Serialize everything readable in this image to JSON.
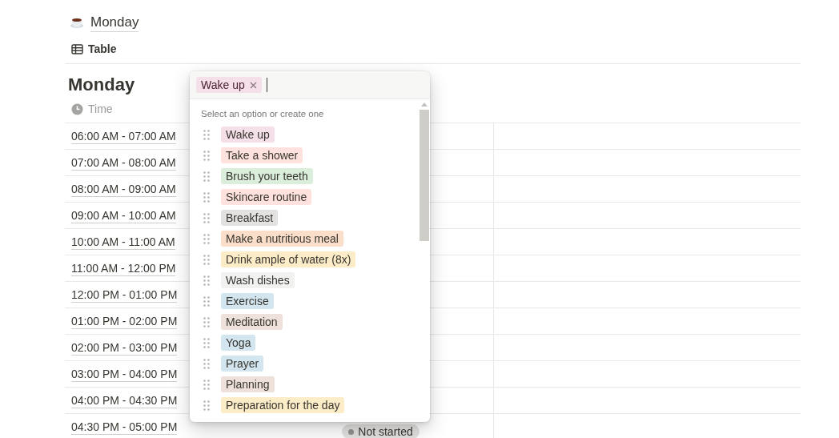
{
  "page": {
    "title": "Monday"
  },
  "view_tab": {
    "label": "Table"
  },
  "table": {
    "title": "Monday",
    "columns": [
      {
        "label": "Time"
      }
    ],
    "rows": [
      {
        "time": "06:00 AM - 07:00 AM"
      },
      {
        "time": "07:00 AM - 08:00 AM"
      },
      {
        "time": "08:00 AM - 09:00 AM"
      },
      {
        "time": "09:00 AM - 10:00 AM"
      },
      {
        "time": "10:00 AM - 11:00 AM"
      },
      {
        "time": "11:00 AM - 12:00 PM"
      },
      {
        "time": "12:00 PM - 01:00 PM"
      },
      {
        "time": "01:00 PM - 02:00 PM"
      },
      {
        "time": "02:00 PM - 03:00 PM"
      },
      {
        "time": "03:00 PM - 04:00 PM"
      },
      {
        "time": "04:00 PM - 04:30 PM"
      },
      {
        "time": "04:30 PM - 05:00 PM",
        "status": "Not started"
      }
    ]
  },
  "select_menu": {
    "selected_tags": [
      {
        "label": "Wake up",
        "color": "#f5e0e9"
      }
    ],
    "hint": "Select an option or create one",
    "options": [
      {
        "label": "Wake up",
        "color": "#f5e0e9"
      },
      {
        "label": "Take a shower",
        "color": "#ffe2dd"
      },
      {
        "label": "Brush your teeth",
        "color": "#dbeddb"
      },
      {
        "label": "Skincare routine",
        "color": "#ffe2dd"
      },
      {
        "label": "Breakfast",
        "color": "#e3e2e0"
      },
      {
        "label": "Make a nutritious meal",
        "color": "#fadec9"
      },
      {
        "label": "Drink ample of water (8x)",
        "color": "#fdecc8"
      },
      {
        "label": "Wash dishes",
        "color": "#f1f1ef"
      },
      {
        "label": "Exercise",
        "color": "#d3e5ef"
      },
      {
        "label": "Meditation",
        "color": "#eee0da"
      },
      {
        "label": "Yoga",
        "color": "#d3e5ef"
      },
      {
        "label": "Prayer",
        "color": "#d3e5ef"
      },
      {
        "label": "Planning",
        "color": "#eee0da"
      },
      {
        "label": "Preparation for the day",
        "color": "#fdecc8"
      }
    ]
  }
}
